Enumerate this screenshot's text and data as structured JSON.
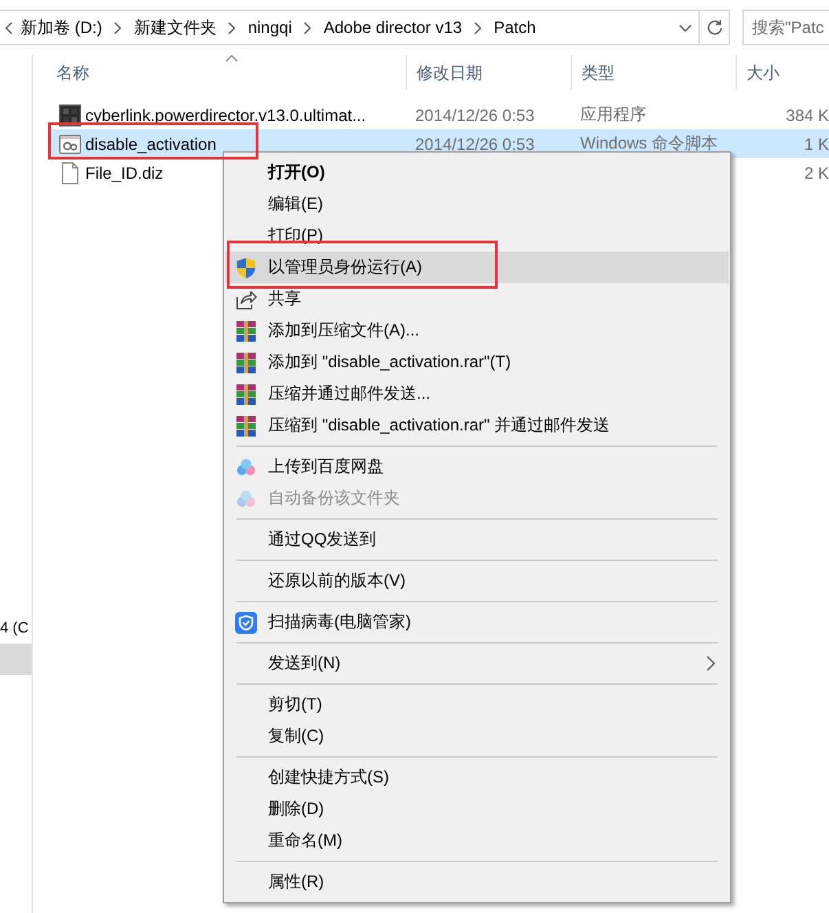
{
  "address_bar": {
    "breadcrumbs": [
      "新加卷 (D:)",
      "新建文件夹",
      "ningqi",
      "Adobe director v13",
      "Patch"
    ]
  },
  "search": {
    "placeholder": "搜索\"Patc"
  },
  "navigation": {
    "items": [
      {
        "label": "4 (C",
        "selected": false
      },
      {
        "selected": true
      }
    ]
  },
  "table": {
    "columns": [
      {
        "label": "名称",
        "sorted": true
      },
      {
        "label": "修改日期"
      },
      {
        "label": "类型"
      },
      {
        "label": "大小"
      }
    ],
    "rows": [
      {
        "name": "cyberlink.powerdirector.v13.0.ultimat...",
        "date": "2014/12/26 0:53",
        "type": "应用程序",
        "size": "384 K",
        "kind": "app",
        "selected": false
      },
      {
        "name": "disable_activation",
        "date": "2014/12/26 0:53",
        "type": "Windows 命令脚本",
        "size": "1 K",
        "kind": "script",
        "selected": true,
        "annotated": true
      },
      {
        "name": "File_ID.diz",
        "size": "2 K",
        "kind": "document",
        "selected": false
      }
    ]
  },
  "context_menu": {
    "groups": [
      {
        "items": [
          {
            "label": "打开(O)",
            "kind": "plain",
            "selected": false,
            "default": true
          },
          {
            "label": "编辑(E)",
            "kind": "plain",
            "selected": false
          },
          {
            "label": "打印(P)",
            "kind": "plain",
            "selected": false
          },
          {
            "label": "以管理员身份运行(A)",
            "kind": "shield",
            "selected": true,
            "annotated": true
          },
          {
            "label": "共享",
            "kind": "share",
            "selected": false
          },
          {
            "label": "添加到压缩文件(A)...",
            "kind": "books",
            "selected": false
          },
          {
            "label": "添加到 \"disable_activation.rar\"(T)",
            "kind": "books",
            "selected": false
          },
          {
            "label": "压缩并通过邮件发送...",
            "kind": "books",
            "selected": false
          },
          {
            "label": "压缩到 \"disable_activation.rar\" 并通过邮件发送",
            "kind": "books",
            "selected": false
          }
        ]
      },
      {
        "items": [
          {
            "label": "上传到百度网盘",
            "kind": "cloud",
            "selected": false
          },
          {
            "label": "自动备份该文件夹",
            "kind": "cloud",
            "selected": false,
            "disabled": true
          }
        ]
      },
      {
        "items": [
          {
            "label": "通过QQ发送到",
            "kind": "plain",
            "selected": false
          }
        ]
      },
      {
        "items": [
          {
            "label": "还原以前的版本(V)",
            "kind": "plain",
            "selected": false
          }
        ]
      },
      {
        "items": [
          {
            "label": "扫描病毒(电脑管家)",
            "kind": "guard",
            "selected": false
          }
        ]
      },
      {
        "items": [
          {
            "label": "发送到(N)",
            "kind": "plain",
            "selected": false,
            "submenu": true
          }
        ]
      },
      {
        "items": [
          {
            "label": "剪切(T)",
            "kind": "plain",
            "selected": false
          },
          {
            "label": "复制(C)",
            "kind": "plain",
            "selected": false
          }
        ]
      },
      {
        "items": [
          {
            "label": "创建快捷方式(S)",
            "kind": "plain",
            "selected": false
          },
          {
            "label": "删除(D)",
            "kind": "plain",
            "selected": false
          },
          {
            "label": "重命名(M)",
            "kind": "plain",
            "selected": false
          }
        ]
      },
      {
        "items": [
          {
            "label": "属性(R)",
            "kind": "plain",
            "selected": false
          }
        ]
      }
    ]
  }
}
